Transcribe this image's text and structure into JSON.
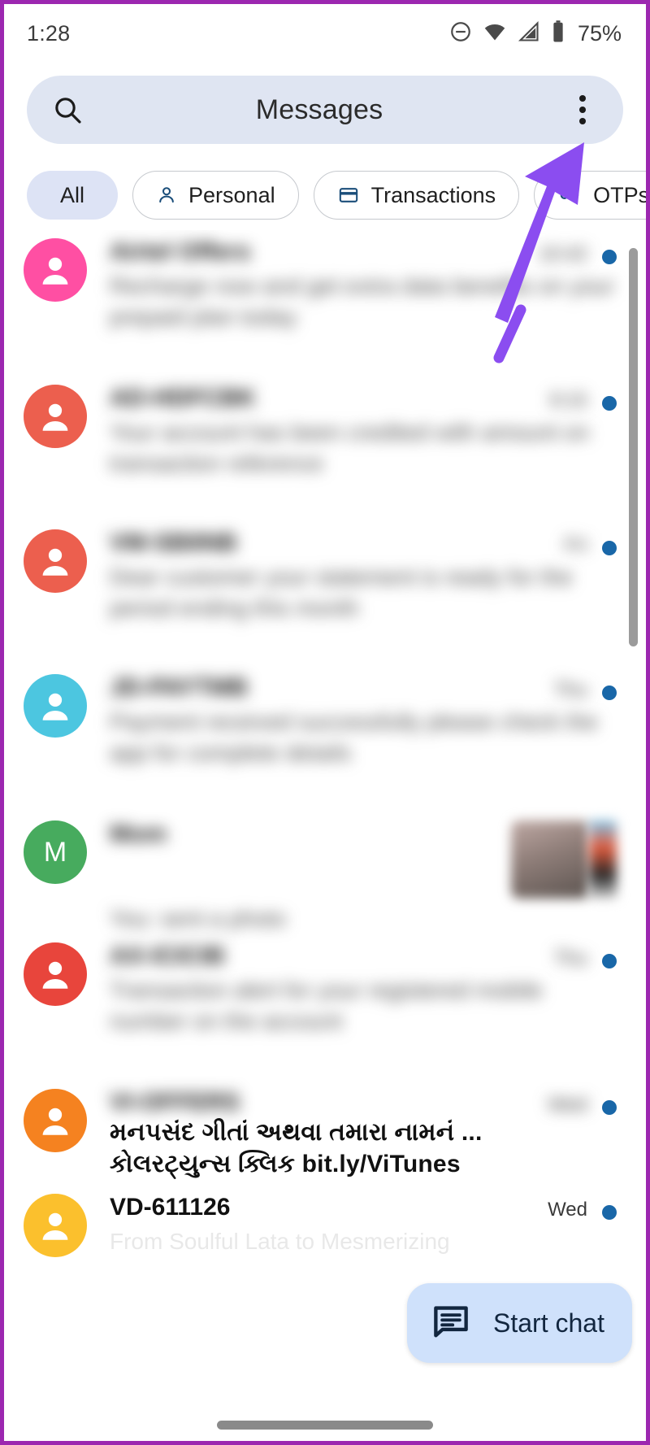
{
  "status_bar": {
    "time": "1:28",
    "battery_percent": "75%",
    "icons": [
      "do-not-disturb-icon",
      "wifi-icon",
      "cellular-signal-icon",
      "battery-icon"
    ]
  },
  "search_bar": {
    "title": "Messages",
    "search_icon": "search-icon",
    "overflow_icon": "more-vert-icon"
  },
  "filter_chips": [
    {
      "label": "All",
      "icon": null,
      "selected": true
    },
    {
      "label": "Personal",
      "icon": "person-icon",
      "selected": false
    },
    {
      "label": "Transactions",
      "icon": "credit-card-icon",
      "selected": false
    },
    {
      "label": "OTPs",
      "icon": "key-icon",
      "selected": false
    }
  ],
  "conversations": [
    {
      "sender": "",
      "time": "",
      "snippet": "",
      "avatar_color": "#ff4fa3",
      "avatar_letter": "",
      "unread": true,
      "blurred": true,
      "thumb": false
    },
    {
      "sender": "",
      "time": "",
      "snippet": "",
      "avatar_color": "#ec5f4e",
      "avatar_letter": "",
      "unread": true,
      "blurred": true,
      "thumb": false
    },
    {
      "sender": "",
      "time": "",
      "snippet": "",
      "avatar_color": "#ec5f4e",
      "avatar_letter": "",
      "unread": true,
      "blurred": true,
      "thumb": false
    },
    {
      "sender": "",
      "time": "",
      "snippet": "",
      "avatar_color": "#4cc6e0",
      "avatar_letter": "",
      "unread": true,
      "blurred": true,
      "thumb": false
    },
    {
      "sender": "",
      "time": "",
      "snippet": "",
      "avatar_color": "#47ab5e",
      "avatar_letter": "M",
      "unread": false,
      "blurred": true,
      "thumb": true
    },
    {
      "sender": "",
      "time": "",
      "snippet": "",
      "avatar_color": "#e8453c",
      "avatar_letter": "",
      "unread": true,
      "blurred": true,
      "thumb": false
    },
    {
      "sender": "",
      "time": "",
      "snippet": "",
      "avatar_color": "#f58220",
      "avatar_letter": "",
      "unread": true,
      "blurred": true,
      "thumb": false,
      "visible_line_1": "મનપસંદ ગીતાં અથવા તમારા નામનં ...",
      "visible_line_2": "કોલરટ્યુન્સ ક્લિક bit.ly/ViTunes"
    },
    {
      "sender": "VD-611126",
      "time": "Wed",
      "snippet": "From Soulful Lata to Mesmerizing",
      "avatar_color": "#fbc02d",
      "avatar_letter": "",
      "unread": true,
      "blurred": false,
      "thumb": false
    }
  ],
  "fab": {
    "label": "Start chat",
    "icon": "chat-bubble-icon"
  },
  "annotation": {
    "type": "arrow",
    "color": "#8b4df0",
    "points_to": "overflow-menu-button"
  },
  "colors": {
    "search_bar_bg": "#dfe5f2",
    "chip_selected_bg": "#dde3f5",
    "fab_bg": "#cfe1fb",
    "unread_dot": "#1967a8",
    "annotation_purple": "#8b4df0",
    "frame_border": "#9c27b0"
  }
}
